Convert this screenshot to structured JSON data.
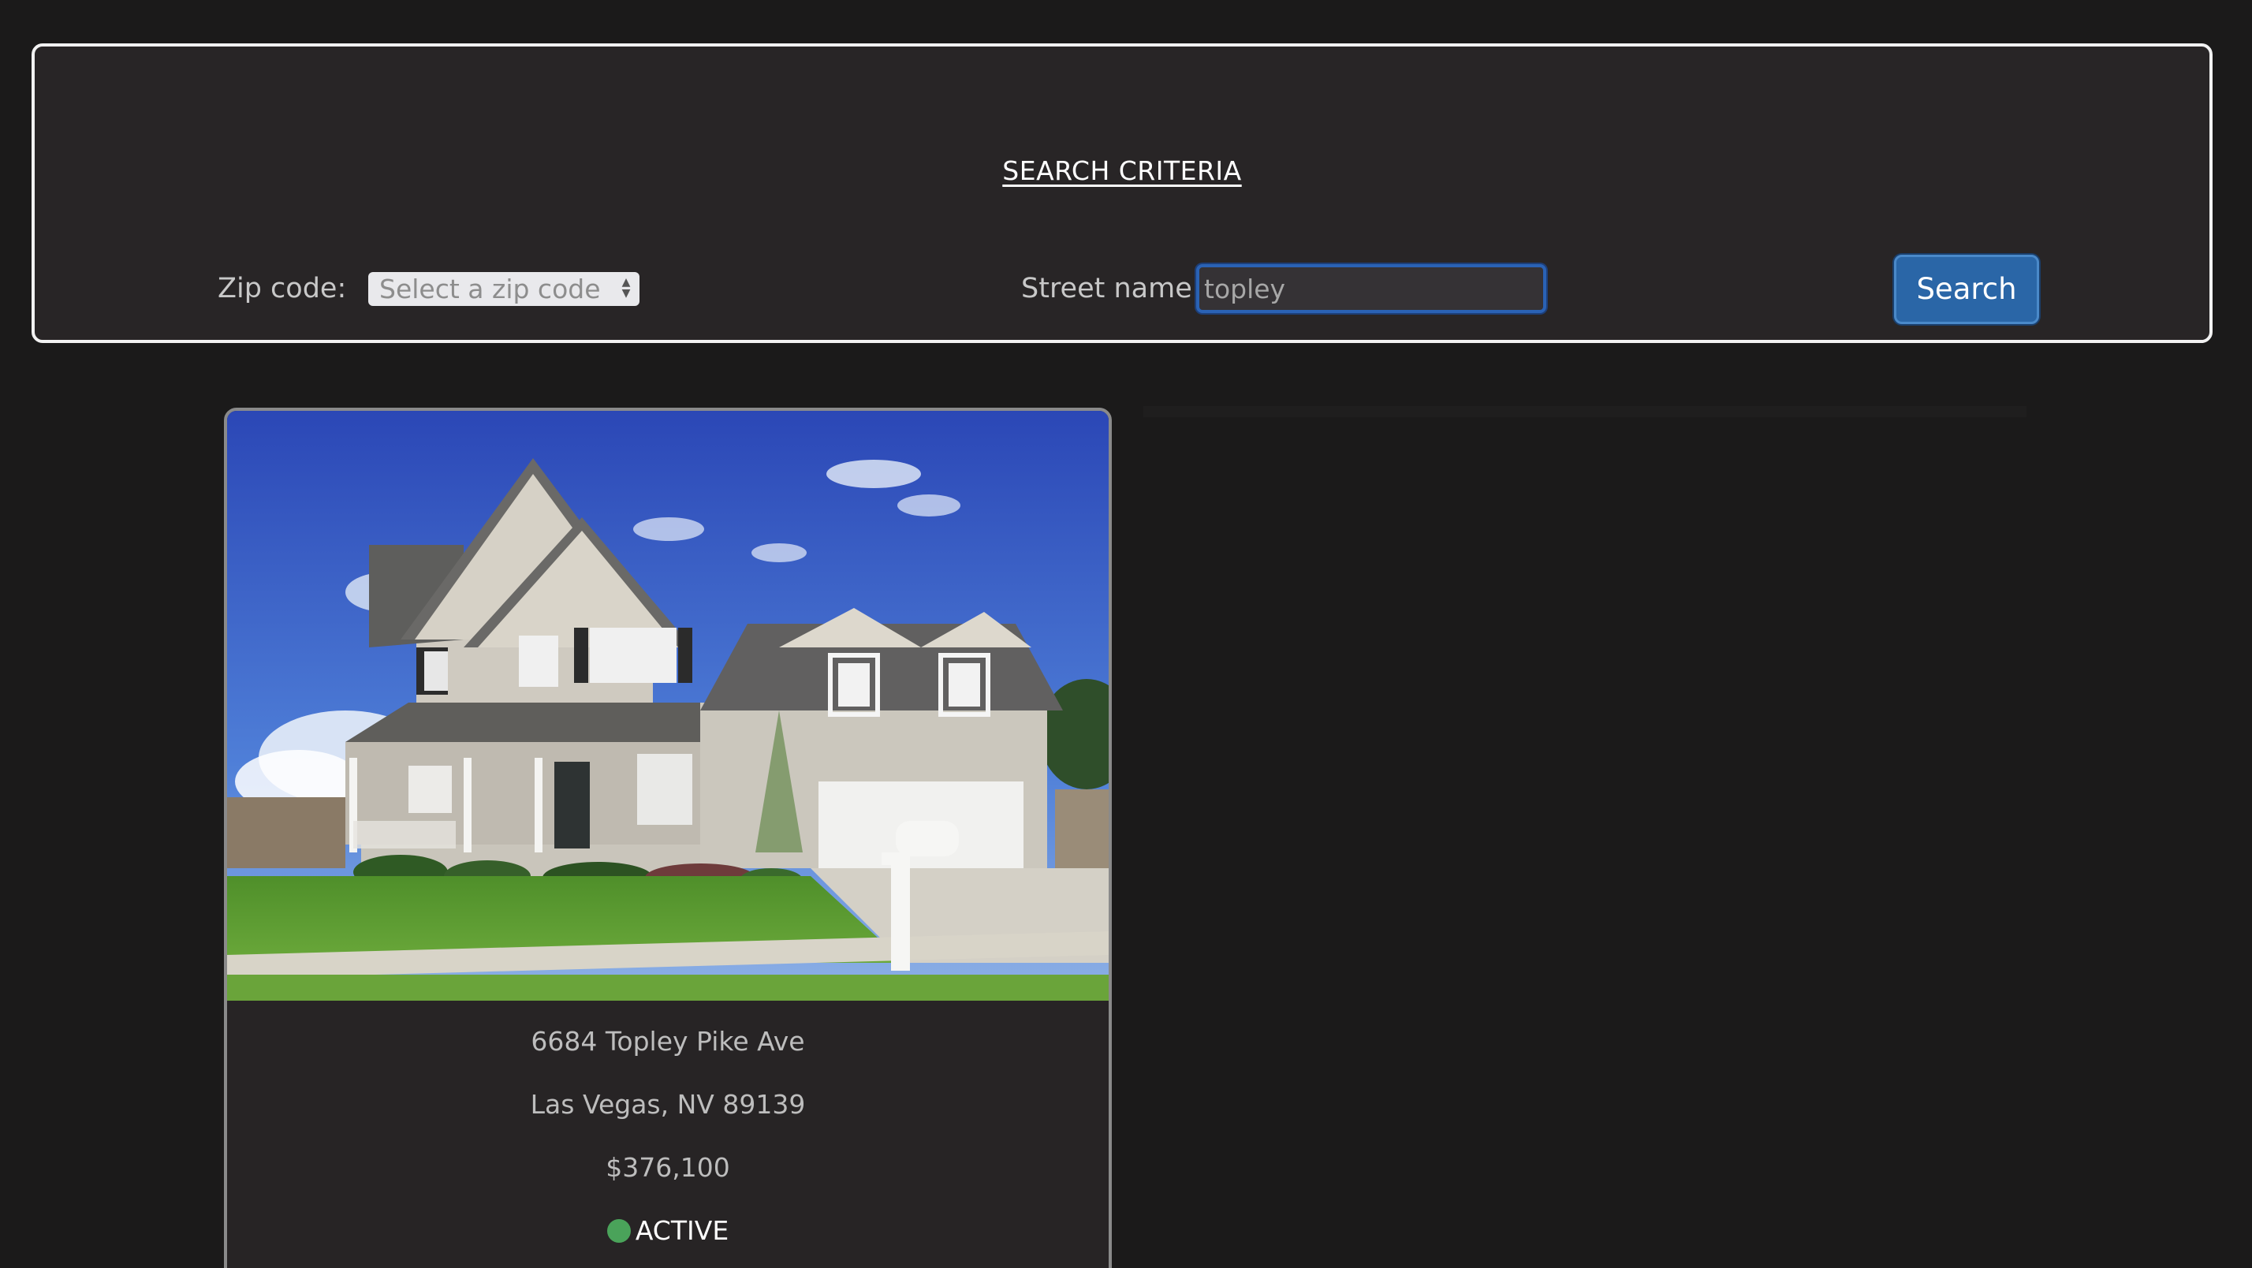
{
  "search_panel": {
    "title": "SEARCH CRITERIA",
    "zip_label": "Zip code:",
    "zip_select_value": "Select a zip code",
    "street_label": "Street name:",
    "street_value": "topley",
    "search_button_label": "Search"
  },
  "listings": [
    {
      "address_line1": "6684 Topley Pike Ave",
      "address_line2": "Las Vegas, NV 89139",
      "price": "$376,100",
      "status": "ACTIVE",
      "status_color": "#4aa35a",
      "photo_icon": "house-photo"
    }
  ],
  "colors": {
    "background": "#1b1a1a",
    "panel": "#282526",
    "accent": "#2a66a7"
  }
}
